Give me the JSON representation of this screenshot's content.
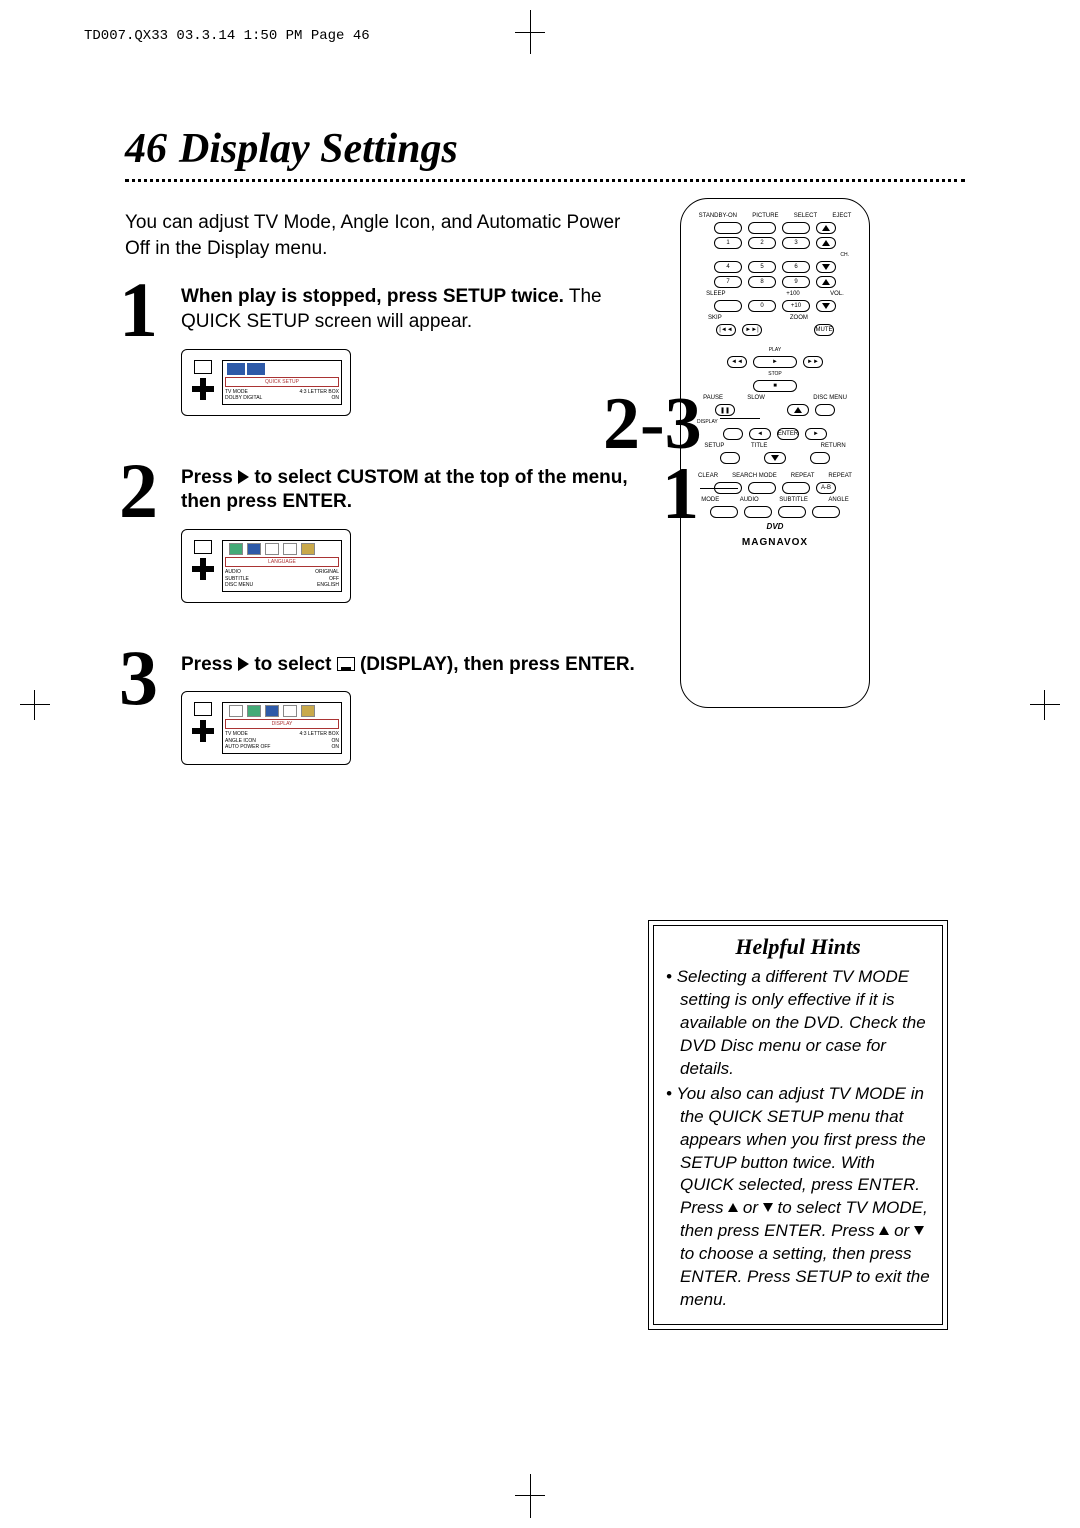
{
  "file_header": "TD007.QX33  03.3.14 1:50 PM  Page 46",
  "page_number": "46",
  "page_title": "Display Settings",
  "intro": "You can adjust TV Mode, Angle Icon, and Automatic Power Off in the Display menu.",
  "steps": [
    {
      "num": "1",
      "bold": "When play is stopped, press SETUP twice.",
      "rest": " The QUICK SETUP screen will appear.",
      "screen": {
        "banner": "QUICK SETUP",
        "rows": [
          {
            "k": "TV MODE",
            "v": "4:3 LETTER BOX"
          },
          {
            "k": "DOLBY DIGITAL",
            "v": "ON"
          }
        ]
      }
    },
    {
      "num": "2",
      "pre": "Press ",
      "mid": " to select CUSTOM at the top of the menu, then press ENTER.",
      "screen": {
        "banner": "LANGUAGE",
        "rows": [
          {
            "k": "AUDIO",
            "v": "ORIGINAL"
          },
          {
            "k": "SUBTITLE",
            "v": "OFF"
          },
          {
            "k": "DISC MENU",
            "v": "ENGLISH"
          }
        ]
      }
    },
    {
      "num": "3",
      "pre": "Press ",
      "mid": " to select ",
      "post": " (DISPLAY), then press ENTER.",
      "screen": {
        "banner": "DISPLAY",
        "rows": [
          {
            "k": "TV MODE",
            "v": "4:3 LETTER BOX"
          },
          {
            "k": "ANGLE ICON",
            "v": "ON"
          },
          {
            "k": "AUTO POWER OFF",
            "v": "ON"
          }
        ]
      }
    }
  ],
  "remote": {
    "top_labels": [
      "STANDBY-ON",
      "PICTURE",
      "SELECT",
      "EJECT"
    ],
    "numpad": [
      "1",
      "2",
      "3",
      "4",
      "5",
      "6",
      "7",
      "8",
      "9",
      "0",
      "+100",
      "+10"
    ],
    "side_labels": {
      "ch": "CH.",
      "vol": "VOL.",
      "sleep": "SLEEP",
      "skip": "SKIP",
      "zoom": "ZOOM",
      "mute": "MUTE"
    },
    "transport": {
      "play": "PLAY",
      "stop": "STOP",
      "rew": "◄◄",
      "ff": "►►",
      "pause": "PAUSE",
      "slow": "SLOW",
      "disc": "DISC MENU",
      "display": "DISPLAY",
      "enter": "ENTER",
      "setup": "SETUP",
      "title": "TITLE",
      "return": "RETURN"
    },
    "bottom_row1": [
      "CLEAR",
      "SEARCH MODE",
      "REPEAT",
      "REPEAT"
    ],
    "bottom_ab": "A-B",
    "bottom_row2": [
      "MODE",
      "AUDIO",
      "SUBTITLE",
      "ANGLE"
    ],
    "dvd": "DVD",
    "brand": "MAGNAVOX"
  },
  "callouts": {
    "right1": "2-3",
    "right2": "1"
  },
  "hints": {
    "title": "Helpful Hints",
    "items": [
      "Selecting a different TV MODE setting is only effective if it is available on the DVD.  Check the DVD Disc menu or case for details.",
      "You also can adjust TV MODE in the QUICK SETUP menu that appears when you first press the SETUP button twice. With QUICK selected, press ENTER. Press ▲ or ▼ to select TV MODE, then press ENTER.  Press ▲ or ▼ to choose a setting, then press ENTER.  Press SETUP to exit the menu."
    ]
  }
}
